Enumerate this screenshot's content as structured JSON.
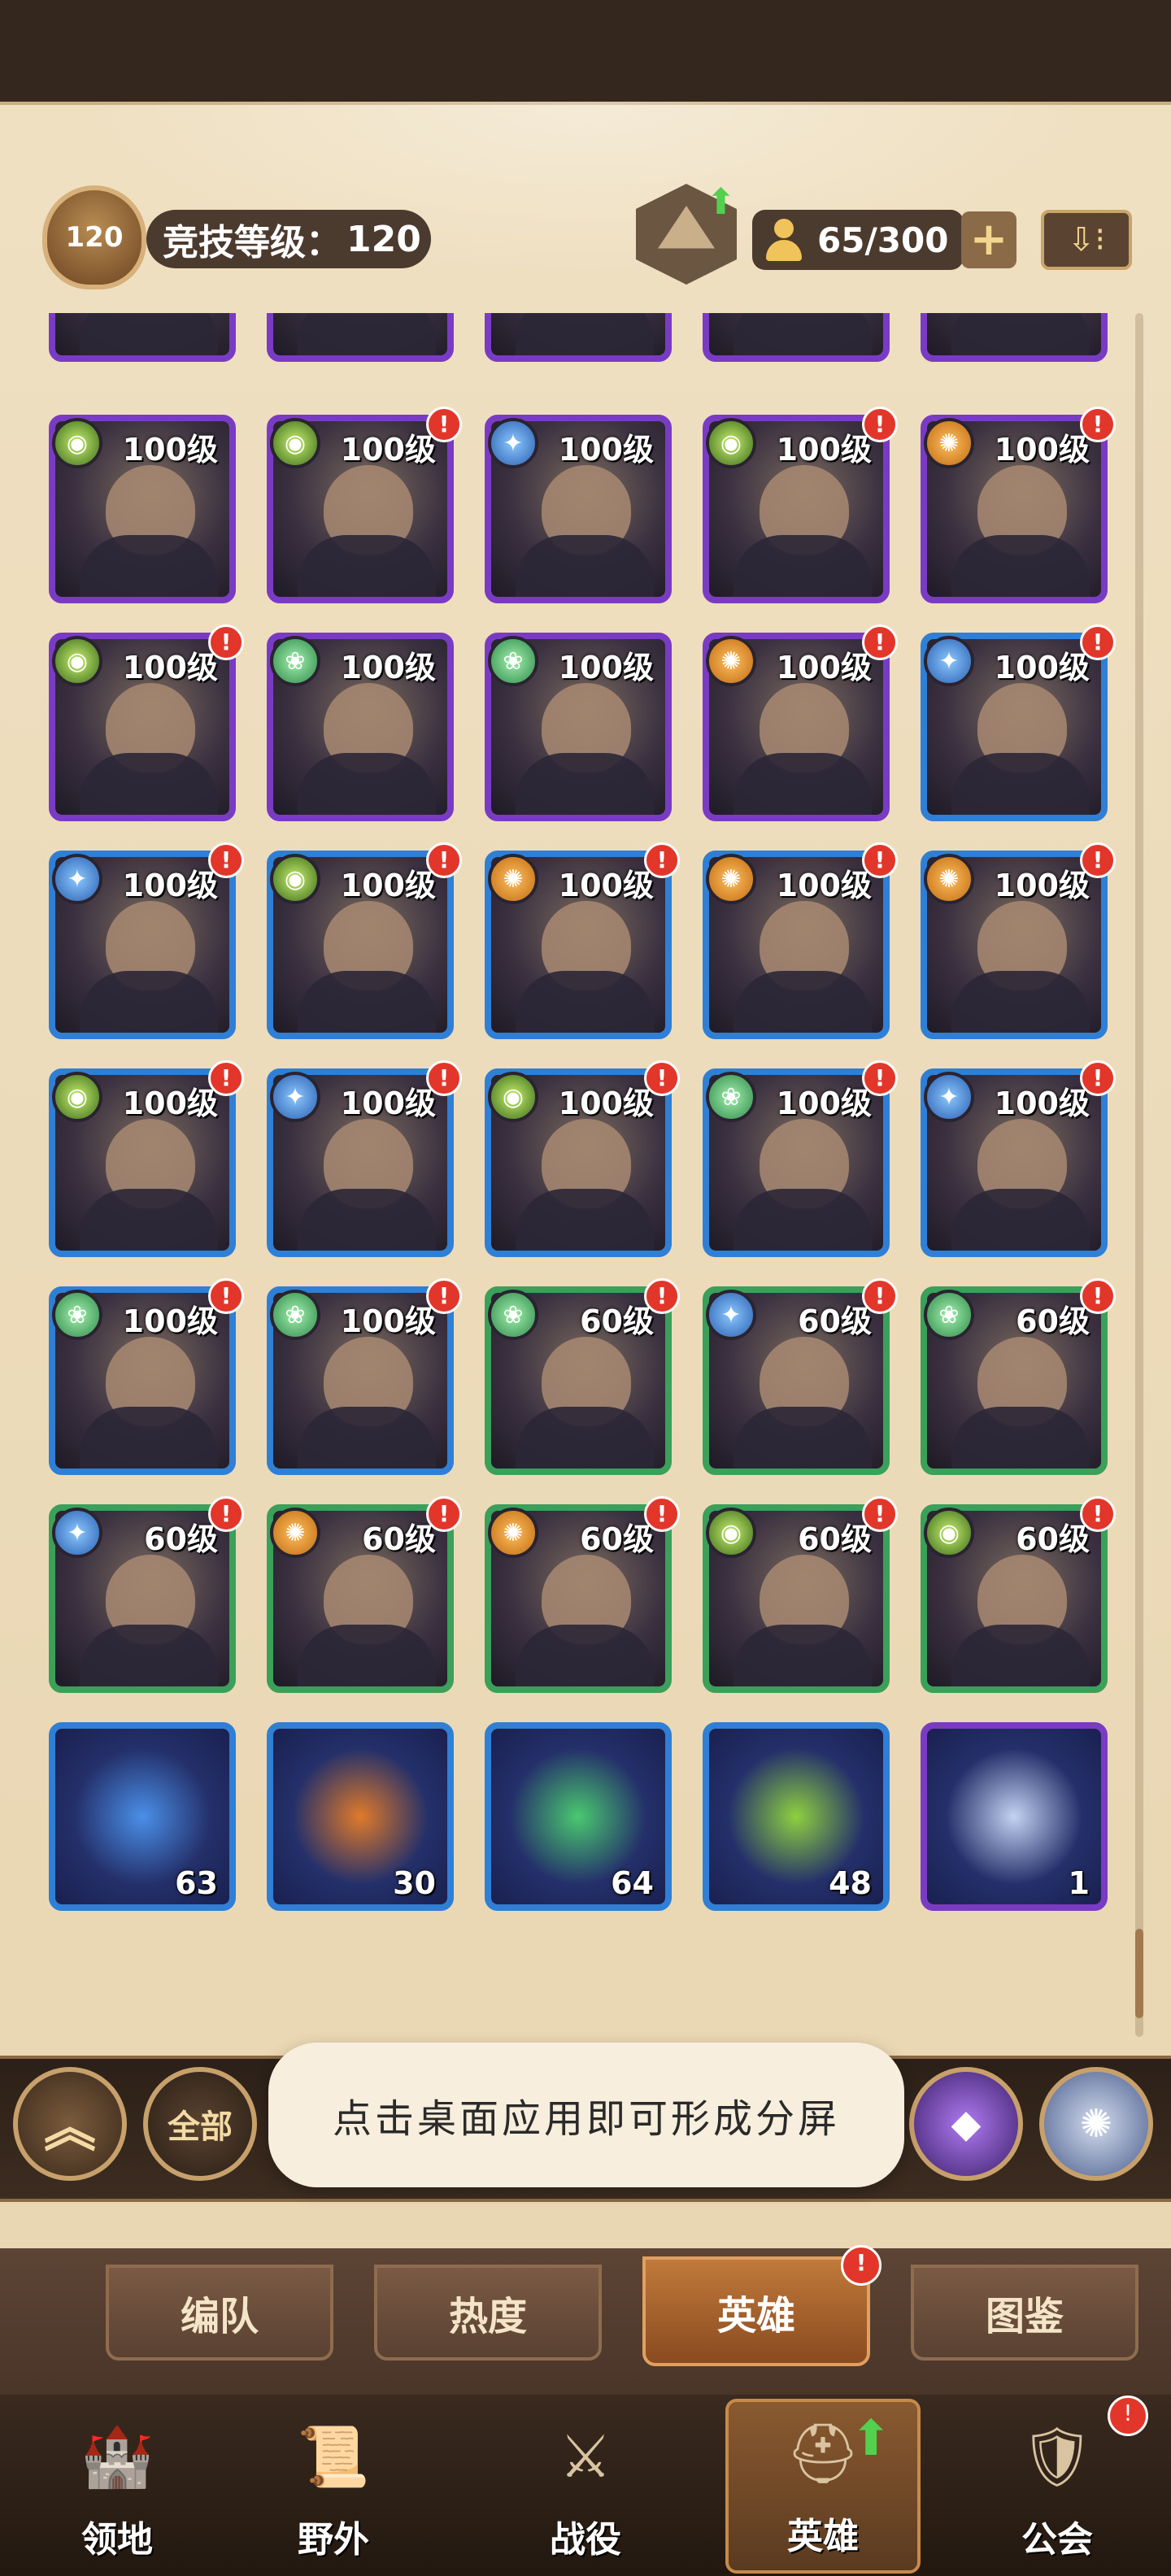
{
  "header": {
    "rank_badge": "120",
    "rank_label": "竞技等级：",
    "rank_value": "120",
    "population": "65/300",
    "plus_label": "+",
    "sort_icon": "sort-icon"
  },
  "heroes": {
    "partial_row": [
      {
        "border": "purple"
      },
      {
        "border": "purple"
      },
      {
        "border": "purple"
      },
      {
        "border": "purple"
      },
      {
        "border": "purple"
      }
    ],
    "rows": [
      [
        {
          "faction": "graveborn",
          "level": "100级",
          "alert": false,
          "border": "purple"
        },
        {
          "faction": "graveborn",
          "level": "100级",
          "alert": true,
          "border": "purple"
        },
        {
          "faction": "lightbearer",
          "level": "100级",
          "alert": false,
          "border": "purple"
        },
        {
          "faction": "graveborn",
          "level": "100级",
          "alert": true,
          "border": "purple"
        },
        {
          "faction": "mauler",
          "level": "100级",
          "alert": true,
          "border": "purple"
        }
      ],
      [
        {
          "faction": "graveborn",
          "level": "100级",
          "alert": true,
          "border": "purple"
        },
        {
          "faction": "wilder",
          "level": "100级",
          "alert": false,
          "border": "purple"
        },
        {
          "faction": "wilder",
          "level": "100级",
          "alert": false,
          "border": "purple"
        },
        {
          "faction": "mauler",
          "level": "100级",
          "alert": true,
          "border": "purple"
        },
        {
          "faction": "lightbearer",
          "level": "100级",
          "alert": true,
          "border": "blue"
        }
      ],
      [
        {
          "faction": "lightbearer",
          "level": "100级",
          "alert": true,
          "border": "blue"
        },
        {
          "faction": "graveborn",
          "level": "100级",
          "alert": true,
          "border": "blue"
        },
        {
          "faction": "mauler",
          "level": "100级",
          "alert": true,
          "border": "blue"
        },
        {
          "faction": "mauler",
          "level": "100级",
          "alert": true,
          "border": "blue"
        },
        {
          "faction": "mauler",
          "level": "100级",
          "alert": true,
          "border": "blue"
        }
      ],
      [
        {
          "faction": "graveborn",
          "level": "100级",
          "alert": true,
          "border": "blue"
        },
        {
          "faction": "lightbearer",
          "level": "100级",
          "alert": true,
          "border": "blue"
        },
        {
          "faction": "graveborn",
          "level": "100级",
          "alert": true,
          "border": "blue"
        },
        {
          "faction": "wilder",
          "level": "100级",
          "alert": true,
          "border": "blue"
        },
        {
          "faction": "lightbearer",
          "level": "100级",
          "alert": true,
          "border": "blue"
        }
      ],
      [
        {
          "faction": "wilder",
          "level": "100级",
          "alert": true,
          "border": "blue"
        },
        {
          "faction": "wilder",
          "level": "100级",
          "alert": true,
          "border": "blue"
        },
        {
          "faction": "wilder",
          "level": "60级",
          "alert": true,
          "border": "green"
        },
        {
          "faction": "lightbearer",
          "level": "60级",
          "alert": true,
          "border": "green"
        },
        {
          "faction": "wilder",
          "level": "60级",
          "alert": true,
          "border": "green"
        }
      ],
      [
        {
          "faction": "lightbearer",
          "level": "60级",
          "alert": true,
          "border": "green"
        },
        {
          "faction": "mauler",
          "level": "60级",
          "alert": true,
          "border": "green"
        },
        {
          "faction": "mauler",
          "level": "60级",
          "alert": true,
          "border": "green"
        },
        {
          "faction": "graveborn",
          "level": "60级",
          "alert": true,
          "border": "green"
        },
        {
          "faction": "graveborn",
          "level": "60级",
          "alert": true,
          "border": "green"
        }
      ]
    ],
    "materials": [
      {
        "name": "lightbearer-essence",
        "count": "63",
        "color": "#4a8fe8"
      },
      {
        "name": "mauler-essence",
        "count": "30",
        "color": "#e07a2a"
      },
      {
        "name": "wilder-essence",
        "count": "64",
        "color": "#4ac870"
      },
      {
        "name": "graveborn-essence",
        "count": "48",
        "color": "#8ed040"
      },
      {
        "name": "celestial-shard",
        "count": "1",
        "color": "#c4d2f2"
      }
    ]
  },
  "filter_bar": {
    "all_label": "全部",
    "toast": "点击桌面应用即可形成分屏"
  },
  "tabs": [
    {
      "label": "编队",
      "active": false,
      "alert": false
    },
    {
      "label": "热度",
      "active": false,
      "alert": false
    },
    {
      "label": "英雄",
      "active": true,
      "alert": true
    },
    {
      "label": "图鉴",
      "active": false,
      "alert": false
    }
  ],
  "alert_mark": "!",
  "bottom_nav": [
    {
      "label": "领地",
      "icon": "castle-icon",
      "active": false,
      "alert": false
    },
    {
      "label": "野外",
      "icon": "scroll-map-icon",
      "active": false,
      "alert": false
    },
    {
      "label": "战役",
      "icon": "crossed-swords-icon",
      "active": false,
      "alert": false
    },
    {
      "label": "英雄",
      "icon": "helmet-icon",
      "active": true,
      "alert": false
    },
    {
      "label": "公会",
      "icon": "shield-emblem-icon",
      "active": false,
      "alert": true
    }
  ]
}
